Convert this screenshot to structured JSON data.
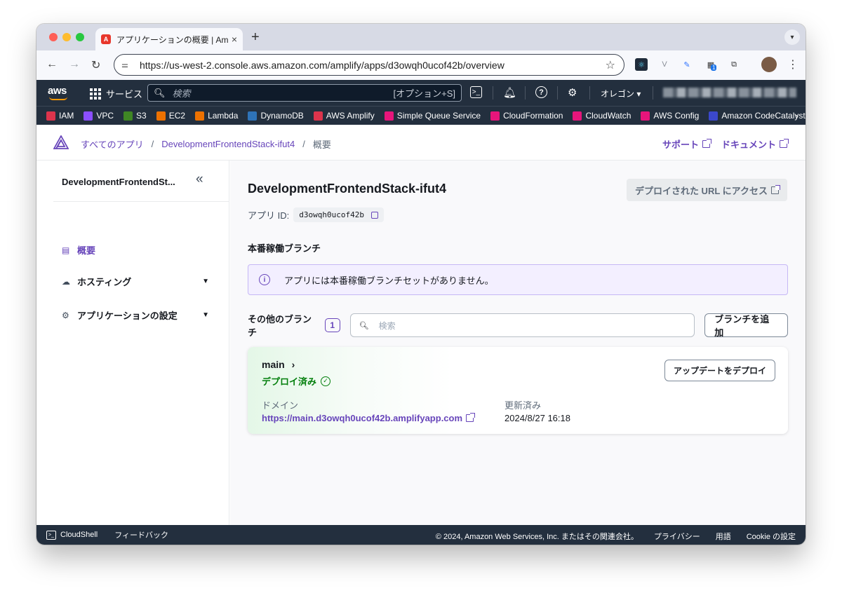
{
  "browser": {
    "tab_title": "アプリケーションの概要 | Amplify",
    "tab_close": "×",
    "new_tab": "+",
    "url": "https://us-west-2.console.aws.amazon.com/amplify/apps/d3owqh0ucof42b/overview",
    "ext_badge": "1"
  },
  "aws_nav": {
    "logo": "aws",
    "services_label": "サービス",
    "search_placeholder": "検索",
    "search_shortcut": "[オプション+S]",
    "region": "オレゴン ▾"
  },
  "favorites": [
    {
      "label": "IAM",
      "color": "#dd344c"
    },
    {
      "label": "VPC",
      "color": "#8c4fff"
    },
    {
      "label": "S3",
      "color": "#3f8624"
    },
    {
      "label": "EC2",
      "color": "#ed7100"
    },
    {
      "label": "Lambda",
      "color": "#ed7100"
    },
    {
      "label": "DynamoDB",
      "color": "#2e73b8"
    },
    {
      "label": "AWS Amplify",
      "color": "#dd344c"
    },
    {
      "label": "Simple Queue Service",
      "color": "#e7157b"
    },
    {
      "label": "CloudFormation",
      "color": "#e7157b"
    },
    {
      "label": "CloudWatch",
      "color": "#e7157b"
    },
    {
      "label": "AWS Config",
      "color": "#e7157b"
    },
    {
      "label": "Amazon CodeCatalyst",
      "color": "#3b48cc"
    }
  ],
  "breadcrumb": {
    "all_apps": "すべてのアプリ",
    "app": "DevelopmentFrontendStack-ifut4",
    "current": "概要",
    "sep": "/"
  },
  "top_links": {
    "support": "サポート",
    "docs": "ドキュメント"
  },
  "sidebar": {
    "title": "DevelopmentFrontendSt...",
    "items": [
      {
        "label": "概要"
      },
      {
        "label": "ホスティング"
      },
      {
        "label": "アプリケーションの設定"
      }
    ]
  },
  "main": {
    "app_name": "DevelopmentFrontendStack-ifut4",
    "visit_button": "デプロイされた URL にアクセス",
    "app_id_label": "アプリ ID:",
    "app_id": "d3owqh0ucof42b",
    "production_heading": "本番稼働ブランチ",
    "production_info": "アプリには本番稼働ブランチセットがありません。",
    "other_branches_label": "その他のブランチ",
    "other_branches_count": "1",
    "search_placeholder": "検索",
    "add_branch_button": "ブランチを追加",
    "branch": {
      "name": "main",
      "status": "デプロイ済み",
      "redeploy_button": "アップデートをデプロイ",
      "domain_label": "ドメイン",
      "domain_url": "https://main.d3owqh0ucof42b.amplifyapp.com",
      "updated_label": "更新済み",
      "updated_value": "2024/8/27 16:18"
    }
  },
  "footer": {
    "cloudshell": "CloudShell",
    "feedback": "フィードバック",
    "copyright": "© 2024, Amazon Web Services, Inc. またはその関連会社。",
    "privacy": "プライバシー",
    "terms": "用語",
    "cookie": "Cookie の設定"
  }
}
